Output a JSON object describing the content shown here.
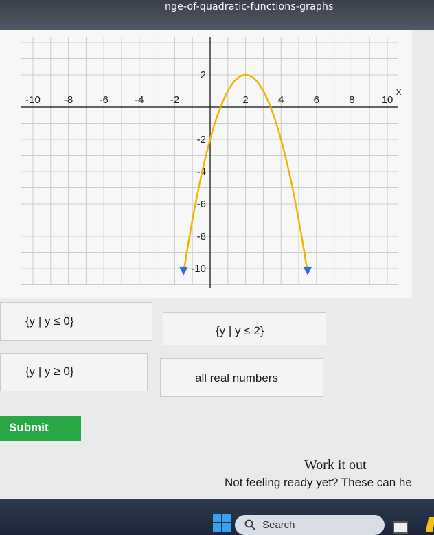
{
  "browser": {
    "url_fragment": "nge-of-quadratic-functions-graphs"
  },
  "chart_data": {
    "type": "line",
    "title": "",
    "xlabel": "x",
    "ylabel": "",
    "xlim": [
      -10,
      10
    ],
    "ylim": [
      -10,
      2
    ],
    "x_ticks": [
      -10,
      -8,
      -6,
      -4,
      -2,
      2,
      4,
      6,
      8,
      10
    ],
    "x_tick_labels": [
      "-10",
      "-8",
      "-6",
      "-4",
      "-2",
      "2",
      "4",
      "6",
      "8",
      "10"
    ],
    "y_ticks": [
      2,
      -2,
      -4,
      -6,
      -8,
      -10
    ],
    "y_tick_labels": [
      "2",
      "-2",
      "-4",
      "-6",
      "-8",
      "-10"
    ],
    "grid": true,
    "series": [
      {
        "x": [
          -1.5,
          -1,
          0,
          1,
          2,
          3,
          4,
          5,
          5.5
        ],
        "y": [
          -10.25,
          -7,
          -2,
          1,
          2,
          1,
          -2,
          -7,
          -10.25
        ],
        "color": "#f0b400",
        "arrows_both_ends": true
      }
    ],
    "curve_color": "#f0b400",
    "arrow_color": "#2f6fd6"
  },
  "answers": [
    {
      "label": "{y | y ≤ 0}"
    },
    {
      "label": "{y | y ≤ 2}"
    },
    {
      "label": "{y | y ≥ 0}"
    },
    {
      "label": "all real numbers"
    }
  ],
  "submit_label": "Submit",
  "work_it_out": {
    "title": "Work it out",
    "subtitle": "Not feeling ready yet? These can he"
  },
  "taskbar": {
    "search_label": "Search",
    "accent": "#3aa0f0"
  }
}
